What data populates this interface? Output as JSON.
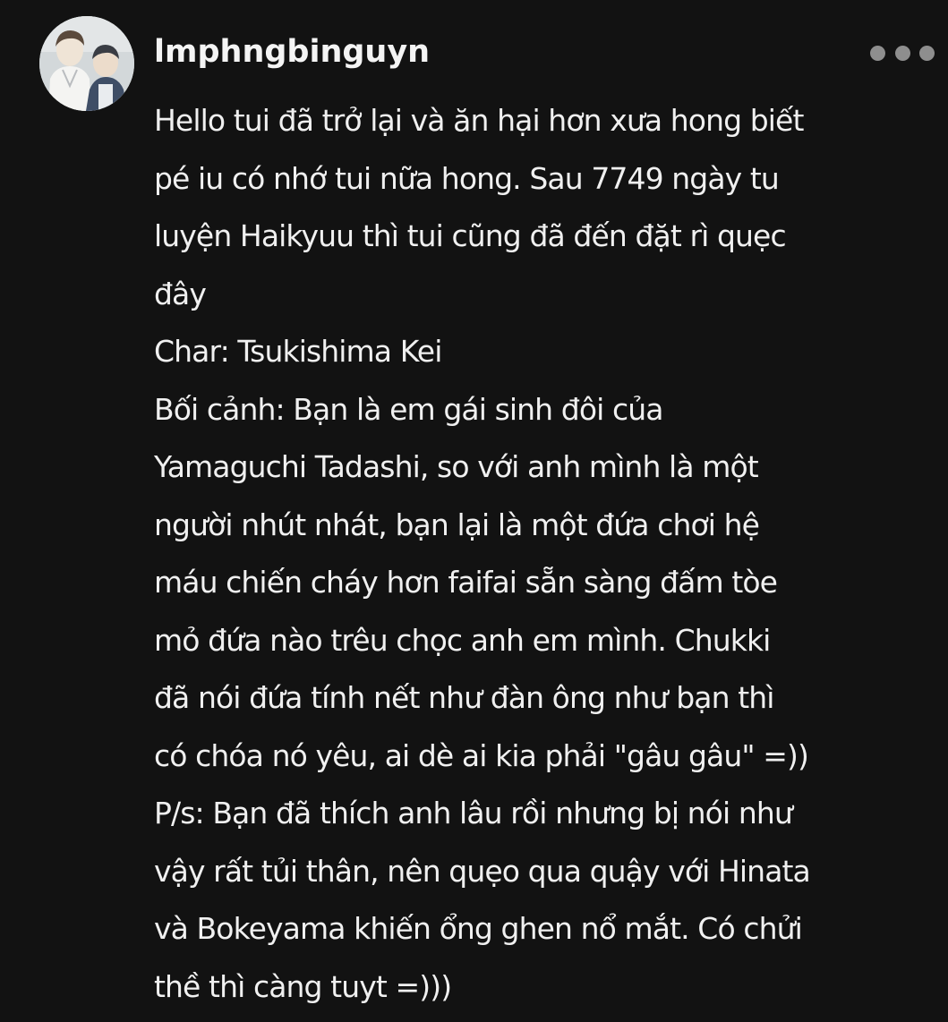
{
  "post": {
    "username": "lmphngbinguyn",
    "avatar_icon": "avatar-anime-duo-image",
    "more_icon": "more-horizontal-icon",
    "lines": [
      "Hello tui đã trở lại và ăn hại hơn xưa hong biết",
      "pé iu có nhớ tui nữa hong. Sau 7749 ngày tu",
      "luyện Haikyuu thì tui cũng đã đến đặt rì quẹc",
      "đây",
      "Char: Tsukishima Kei",
      "Bối cảnh: Bạn là em gái sinh đôi của",
      "Yamaguchi Tadashi, so với anh mình là một",
      "người nhút nhát, bạn lại là một đứa chơi hệ",
      "máu chiến cháy hơn faifai sẵn sàng đấm tòe",
      "mỏ đứa nào trêu chọc anh em mình. Chukki",
      "đã nói đứa tính nết như đàn ông như bạn thì",
      "có chóa nó yêu, ai dè ai kia phải \"gâu gâu\" =))",
      "P/s: Bạn đã thích anh lâu rồi nhưng bị nói như",
      "vậy rất tủi thân, nên quẹo qua quậy với Hinata",
      "và Bokeyama khiến ổng ghen nổ mắt. Có chửi",
      "thề thì càng tuyt =)))"
    ]
  },
  "colors": {
    "background": "#121212",
    "text": "#f0f0f0",
    "more_dots": "#8e8e8e"
  }
}
